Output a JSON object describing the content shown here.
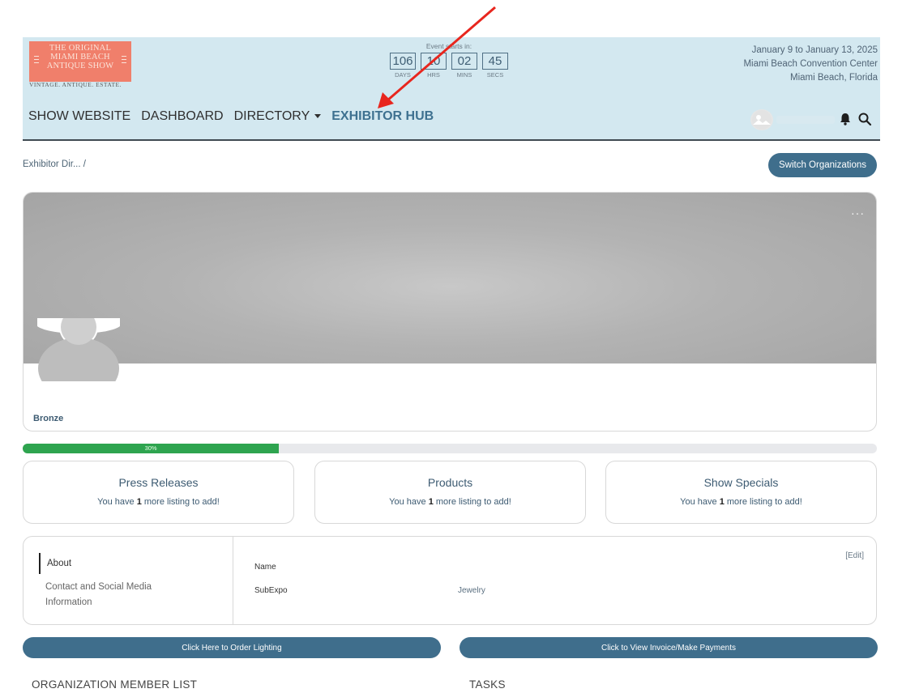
{
  "header": {
    "logo_line1": "THE ORIGINAL",
    "logo_line2": "MIAMI BEACH",
    "logo_line3": "ANTIQUE SHOW",
    "tagline": "VINTAGE. ANTIQUE. ESTATE.",
    "countdown": {
      "label": "Event starts in:",
      "days": "106",
      "hours": "10",
      "mins": "02",
      "secs": "45",
      "days_label": "DAYS",
      "hours_label": "HRS",
      "mins_label": "MINS",
      "secs_label": "SECS"
    },
    "dates": "January 9 to January 13, 2025",
    "venue": "Miami Beach Convention Center",
    "location": "Miami Beach, Florida"
  },
  "nav": {
    "show_website": "SHOW WEBSITE",
    "dashboard": "DASHBOARD",
    "directory": "DIRECTORY",
    "exhibitor_hub": "EXHIBITOR HUB"
  },
  "breadcrumb": "Exhibitor Dir...  /",
  "switch_button": "Switch Organizations",
  "profile": {
    "menu": "···",
    "level": "Bronze"
  },
  "progress": {
    "percent": 30,
    "label": "30%"
  },
  "stats": [
    {
      "title": "Press Releases",
      "pre": "You have ",
      "count": "1",
      "post": " more listing to add!"
    },
    {
      "title": "Products",
      "pre": "You have ",
      "count": "1",
      "post": " more listing to add!"
    },
    {
      "title": "Show Specials",
      "pre": "You have ",
      "count": "1",
      "post": " more listing to add!"
    }
  ],
  "about": {
    "tab_about": "About",
    "tab_contact": "Contact and Social Media Information",
    "edit": "[Edit]",
    "name_label": "Name",
    "subexpo_label": "SubExpo",
    "subexpo_value": "Jewelry"
  },
  "buttons": {
    "lighting": "Click Here to Order Lighting",
    "invoice": "Click to View Invoice/Make Payments"
  },
  "sections": {
    "members": "ORGANIZATION MEMBER LIST",
    "tasks": "TASKS"
  },
  "colors": {
    "header_bg": "#d3e8f0",
    "accent": "#3f6e8c",
    "progress": "#2ea44f",
    "logo": "#f07f6b",
    "annotation_arrow": "#e8261e"
  }
}
